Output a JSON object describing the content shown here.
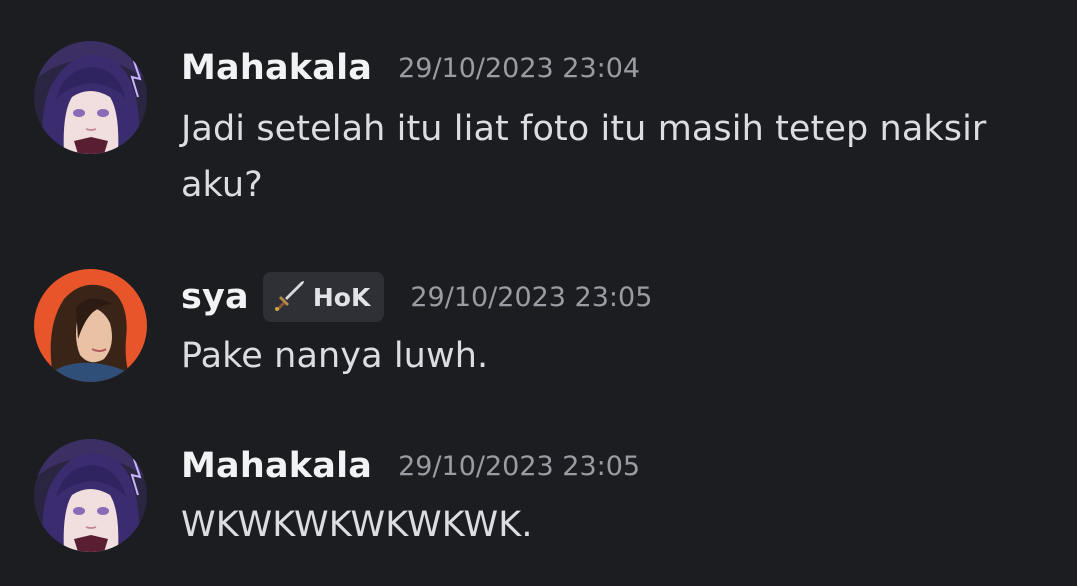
{
  "messages": [
    {
      "username": "Mahakala",
      "timestamp": "29/10/2023 23:04",
      "text": "Jadi setelah itu liat foto itu masih tetep naksir aku?",
      "avatar": "purple-haired-anime-character-avatar"
    },
    {
      "username": "sya",
      "tag": {
        "icon": "sword-icon",
        "label": "HoK"
      },
      "timestamp": "29/10/2023 23:05",
      "text": "Pake nanya luwh.",
      "avatar": "smiling-woman-photo-avatar"
    },
    {
      "username": "Mahakala",
      "timestamp": "29/10/2023 23:05",
      "text": "WKWKWKWKWKWK.",
      "avatar": "purple-haired-anime-character-avatar"
    }
  ],
  "colors": {
    "background": "#1c1d21",
    "username": "#f2f3f5",
    "timestamp": "#9a9ca3",
    "message_text": "#dcdde1",
    "tag_background": "#2e3036",
    "avatar2_background": "#e8552b"
  }
}
